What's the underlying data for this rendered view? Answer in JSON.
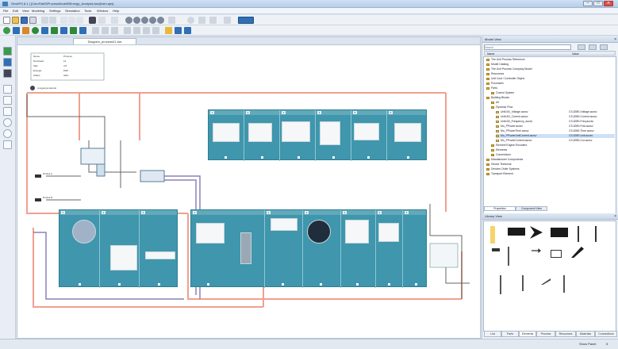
{
  "window": {
    "title": "SimAPS 8.1 | [CreoFlat05ProcessModelBEnergy_Analysis.iws@sim.aps]",
    "minimize": "–",
    "maximize": "□",
    "close": "✕"
  },
  "menu": [
    "File",
    "Edit",
    "View",
    "Modeling",
    "Settings",
    "Simulation",
    "Tools",
    "Window",
    "Help"
  ],
  "toolbar": {
    "row1_icons": [
      "new-icon",
      "open-icon",
      "save-icon",
      "print-icon",
      "undo-icon",
      "redo-icon",
      "cut-icon",
      "copy-icon",
      "paste-icon",
      "find-icon",
      "zoom-in-icon",
      "zoom-out-icon",
      "zoom-fit-icon",
      "zoom-area-icon",
      "grid-icon",
      "help-icon",
      "run-icon"
    ],
    "row2_icons": [
      "pointer-icon",
      "connect-icon",
      "source-icon",
      "sink-icon",
      "queue-icon",
      "station-icon",
      "buffer-icon",
      "tree-icon",
      "panel-icon",
      "chart-icon",
      "table-icon",
      "energy-icon",
      "export-icon"
    ]
  },
  "canvas_tab": "Diagram_process01.iws",
  "properties_box": {
    "rows": [
      {
        "label": "Name",
        "value": "Prozess"
      },
      {
        "label": "Durchsatz",
        "value": "12"
      },
      {
        "label": "Takt",
        "value": "4.5"
      },
      {
        "label": "Energie",
        "value": "kWh"
      },
      {
        "label": "Status",
        "value": "Aktiv"
      }
    ]
  },
  "source_label": "Ausgangsmaterial",
  "inputs": [
    {
      "label": "Rohteil A"
    },
    {
      "label": "Rohteil B"
    }
  ],
  "top_tile": {
    "sub_count": 6,
    "thumbs": [
      "machine-photo",
      "robot-arm",
      "gears",
      "tool-head",
      "chart-graph",
      "control-panel"
    ]
  },
  "left_tile": {
    "sub_count": 3,
    "thumbs": [
      "lathe-chuck",
      "spindle",
      "blade"
    ]
  },
  "right_tile": {
    "sub_count": 6,
    "thumbs": [
      "frame-assembly",
      "press-tool",
      "ring-magnet",
      "gripper",
      "conveyor-hook"
    ]
  },
  "right_panel": {
    "tree_title": "Model View",
    "search_placeholder": "Search",
    "tree_columns": [
      "Name",
      "Value"
    ],
    "tree": [
      {
        "label": "Name",
        "indent": 0
      },
      {
        "label": "The Unit Process Reference",
        "indent": 1
      },
      {
        "label": "Model Catalog",
        "indent": 1
      },
      {
        "label": "The Unit Process Company Model",
        "indent": 1
      },
      {
        "label": "Resources",
        "indent": 1
      },
      {
        "label": "Unit Cost / Controller Object",
        "indent": 1
      },
      {
        "label": "Processes",
        "indent": 1
      },
      {
        "label": "Parts",
        "indent": 1
      },
      {
        "label": "Control System",
        "indent": 2
      },
      {
        "label": "Building Blocks",
        "indent": 1
      },
      {
        "label": "All",
        "indent": 2
      },
      {
        "label": "Dynamic Flow",
        "indent": 2
      },
      {
        "label": "Unit100_Voltage.accsv",
        "indent": 3,
        "value": "CS-8390-Voltage.accsv"
      },
      {
        "label": "Unit100_Current.accsv",
        "indent": 3,
        "value": "CS-8390-Current.accsv"
      },
      {
        "label": "Unit100_Frequency_accsv",
        "indent": 3,
        "value": "CS-8390-Freq.accsv"
      },
      {
        "label": "Mo_PPower.accsv",
        "indent": 3,
        "value": "CS-8390-Pow.accsv"
      },
      {
        "label": "Mo_PPowerTime.accsv",
        "indent": 3,
        "value": "CS-8390-Time.accsv"
      },
      {
        "label": "Mo_PPowerUnitCurrent.accsv",
        "indent": 3,
        "value": "CS-8390-Unit.accsv"
      },
      {
        "label": "Mo_PPowerCurrent.accsv",
        "indent": 3,
        "value": "CS-8390-Cur.accsv"
      },
      {
        "label": "Element Engine Encoders",
        "indent": 2
      },
      {
        "label": "Elements",
        "indent": 2
      },
      {
        "label": "Connections",
        "indent": 2
      },
      {
        "label": "Manufacturer Components",
        "indent": 1
      },
      {
        "label": "Device Technical",
        "indent": 1
      },
      {
        "label": "Devices Order Systems",
        "indent": 1
      },
      {
        "label": "Transport Element",
        "indent": 1
      }
    ],
    "tree_tabs": [
      "Properties",
      "Component View"
    ],
    "palette_title": "Library View",
    "palette_items": [
      "torch-icon",
      "fish-icon",
      "arrow-chevron-icon",
      "double-chevron-icon",
      "spike-icon",
      "separator-icon",
      "bar-icon",
      "rack-icon",
      "tool-arrow-icon",
      "frame-icon",
      "diagonal-icon",
      "hand-icon",
      "rail-icon",
      "arm-icon",
      "pipe-icon"
    ],
    "bottom_tabs": [
      "List",
      "Parts",
      "Elements",
      "Process",
      "Resources",
      "Materials",
      "Connections"
    ]
  },
  "status": {
    "left": "",
    "right_label": "Show Panel",
    "right_value": "5"
  },
  "colors": {
    "tile": "#3f96ad",
    "tile_border": "#2e7e93",
    "wire_red": "#f0a08e",
    "wire_purple": "#8a82b8",
    "wire_dark": "#555"
  }
}
